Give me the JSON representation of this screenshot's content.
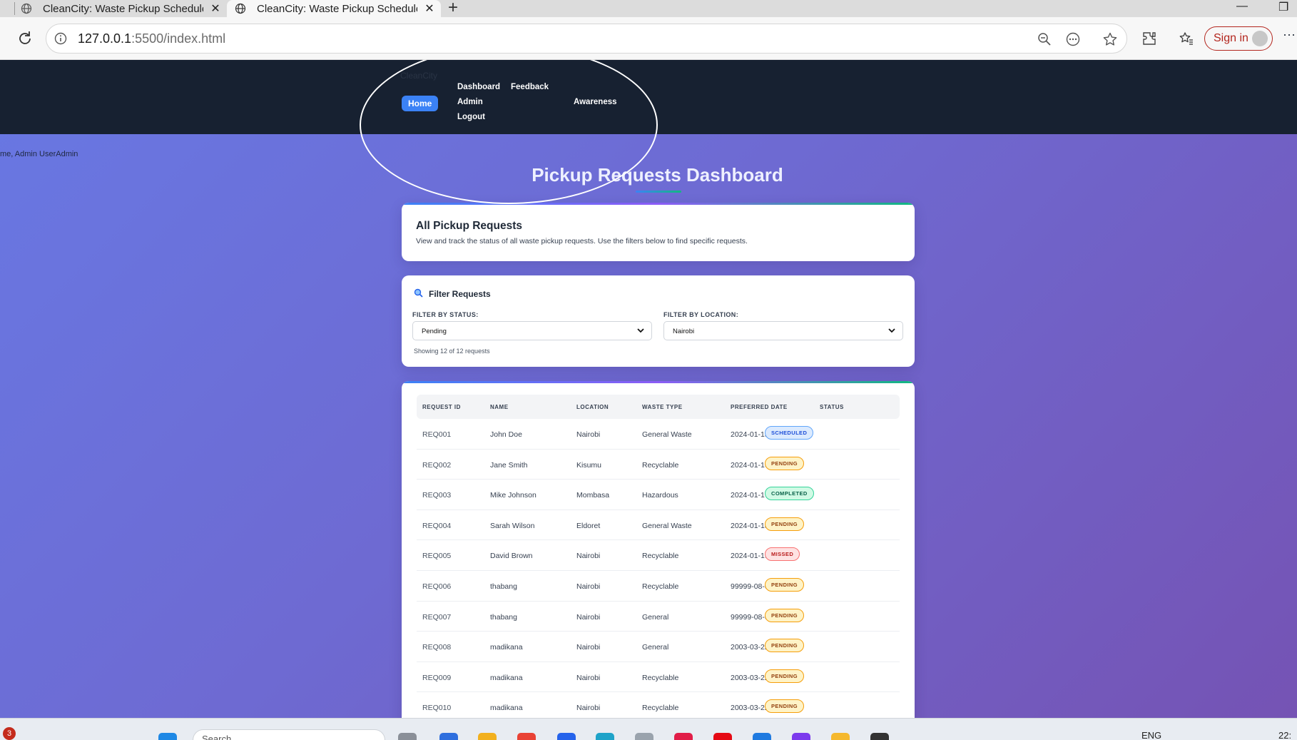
{
  "browser": {
    "tabs": [
      {
        "title": "CleanCity: Waste Pickup Schedule"
      },
      {
        "title": "CleanCity: Waste Pickup Schedule"
      }
    ],
    "url_host": "127.0.0.1",
    "url_rest": ":5500/index.html",
    "sign_in_label": "Sign in"
  },
  "nav": {
    "brand": "CleanCity",
    "links": {
      "home": "Home",
      "dashboard": "Dashboard",
      "feedback": "Feedback",
      "admin": "Admin",
      "awareness": "Awareness",
      "logout": "Logout"
    }
  },
  "welcome": "me, Admin UserAdmin",
  "page": {
    "title": "Pickup Requests Dashboard",
    "intro_heading": "All Pickup Requests",
    "intro_text": "View and track the status of all waste pickup requests. Use the filters below to find specific requests."
  },
  "filters": {
    "heading": "Filter Requests",
    "status_label": "FILTER BY STATUS:",
    "status_value": "Pending",
    "location_label": "FILTER BY LOCATION:",
    "location_value": "Nairobi",
    "count_text": "Showing 12 of 12 requests"
  },
  "table": {
    "headers": [
      "REQUEST ID",
      "NAME",
      "LOCATION",
      "WASTE TYPE",
      "PREFERRED DATE",
      "STATUS"
    ],
    "rows": [
      {
        "id": "REQ001",
        "name": "John Doe",
        "location": "Nairobi",
        "type": "General Waste",
        "date": "2024-01-15",
        "status": "SCHEDULED"
      },
      {
        "id": "REQ002",
        "name": "Jane Smith",
        "location": "Kisumu",
        "type": "Recyclable",
        "date": "2024-01-16",
        "status": "PENDING"
      },
      {
        "id": "REQ003",
        "name": "Mike Johnson",
        "location": "Mombasa",
        "type": "Hazardous",
        "date": "2024-01-17",
        "status": "COMPLETED"
      },
      {
        "id": "REQ004",
        "name": "Sarah Wilson",
        "location": "Eldoret",
        "type": "General Waste",
        "date": "2024-01-18",
        "status": "PENDING"
      },
      {
        "id": "REQ005",
        "name": "David Brown",
        "location": "Nairobi",
        "type": "Recyclable",
        "date": "2024-01-19",
        "status": "MISSED"
      },
      {
        "id": "REQ006",
        "name": "thabang",
        "location": "Nairobi",
        "type": "Recyclable",
        "date": "99999-08-01",
        "status": "PENDING"
      },
      {
        "id": "REQ007",
        "name": "thabang",
        "location": "Nairobi",
        "type": "General",
        "date": "99999-08-01",
        "status": "PENDING"
      },
      {
        "id": "REQ008",
        "name": "madikana",
        "location": "Nairobi",
        "type": "General",
        "date": "2003-03-22",
        "status": "PENDING"
      },
      {
        "id": "REQ009",
        "name": "madikana",
        "location": "Nairobi",
        "type": "Recyclable",
        "date": "2003-03-22",
        "status": "PENDING"
      },
      {
        "id": "REQ010",
        "name": "madikana",
        "location": "Nairobi",
        "type": "Recyclable",
        "date": "2003-03-22",
        "status": "PENDING"
      }
    ]
  },
  "taskbar": {
    "notification_count": "3",
    "search_placeholder": "Search",
    "language": "ENG",
    "clock": "22:"
  },
  "colors": {
    "nav_bg": "#172131",
    "active_nav": "#3b82f6",
    "gradient_start": "#6878e3",
    "gradient_end": "#7553b4"
  }
}
